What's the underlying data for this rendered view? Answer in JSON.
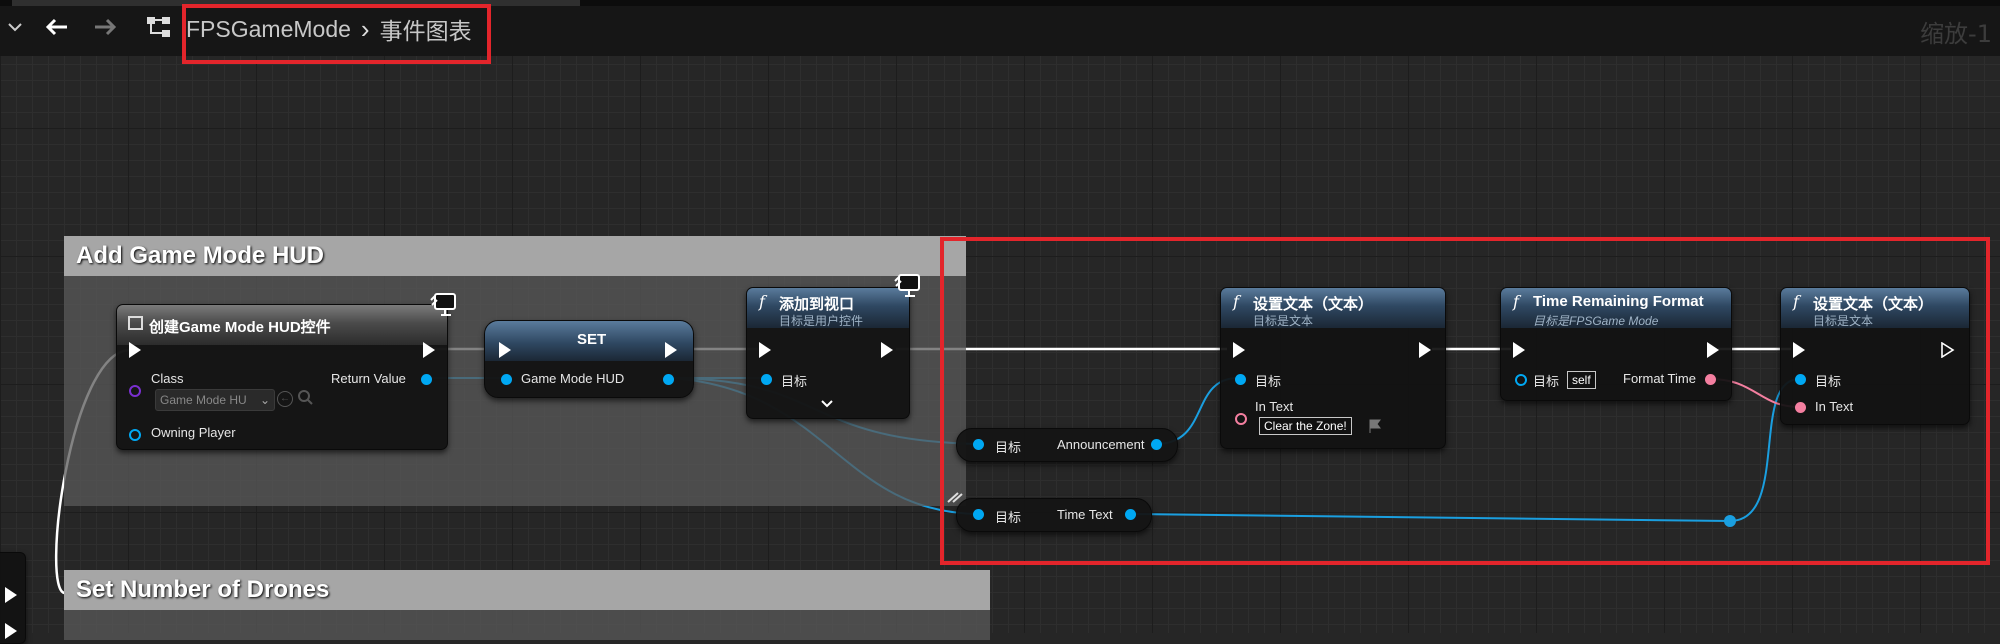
{
  "toolbar": {
    "breadcrumb_root": "FPSGameMode",
    "breadcrumb_separator": "›",
    "breadcrumb_current": "事件图表",
    "zoom_label": "缩放-1"
  },
  "comments": {
    "add_hud_title": "Add Game Mode HUD",
    "drones_title": "Set Number of Drones"
  },
  "nodes": {
    "create_widget": {
      "title": "创建Game Mode HUD控件",
      "class_label": "Class",
      "class_value": "Game Mode HU",
      "owning_player_label": "Owning Player",
      "return_value_label": "Return Value"
    },
    "set": {
      "title": "SET",
      "var_label": "Game Mode HUD"
    },
    "add_to_viewport": {
      "title": "添加到视口",
      "subtitle": "目标是用户控件",
      "target_label": "目标"
    },
    "announcement_get": {
      "target_label": "目标",
      "var_label": "Announcement"
    },
    "time_text_get": {
      "target_label": "目标",
      "var_label": "Time Text"
    },
    "set_text_1": {
      "title": "设置文本（文本）",
      "subtitle": "目标是文本",
      "target_label": "目标",
      "in_text_label": "In Text",
      "in_text_value": "Clear the Zone!"
    },
    "time_format": {
      "title": "Time Remaining Format",
      "subtitle": "目标是FPSGame Mode",
      "target_label": "目标",
      "target_value": "self",
      "output_label": "Format Time"
    },
    "set_text_2": {
      "title": "设置文本（文本）",
      "subtitle": "目标是文本",
      "target_label": "目标",
      "in_text_label": "In Text"
    }
  },
  "colors": {
    "highlight": "#e3252b",
    "object_pin": "#00a8f3",
    "text_pin": "#f47fa0",
    "class_pin": "#7a2fd0",
    "exec_wire": "#ffffff"
  }
}
